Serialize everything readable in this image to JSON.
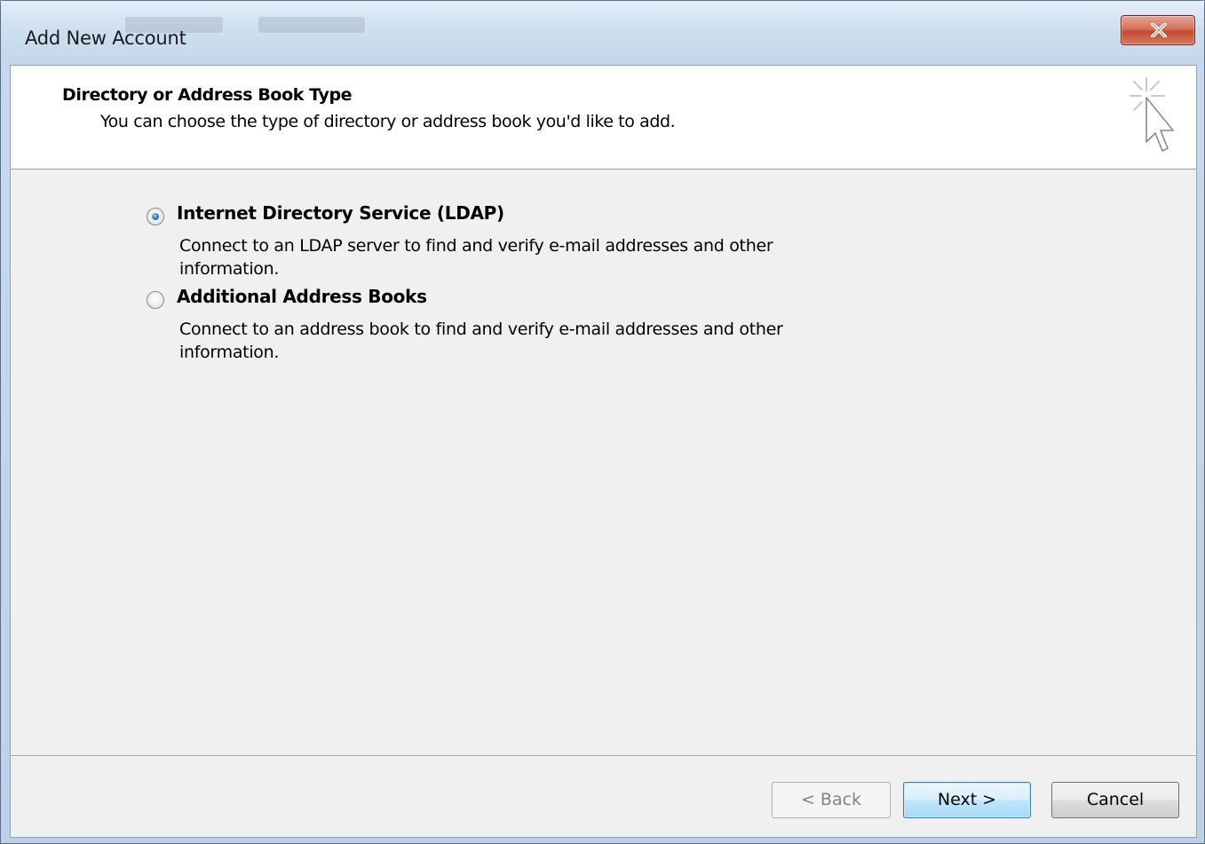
{
  "window": {
    "title": "Add New Account",
    "close_glyph": "x-icon"
  },
  "header": {
    "title": "Directory or Address Book Type",
    "subtitle": "You can choose the type of directory or address book you'd like to add.",
    "icon": "wizard-cursor-icon"
  },
  "options": [
    {
      "label": "Internet Directory Service (LDAP)",
      "description": "Connect to an LDAP server to find and verify e-mail addresses and other information.",
      "selected": true
    },
    {
      "label": "Additional Address Books",
      "description": "Connect to an address book to find and verify e-mail addresses and other information.",
      "selected": false
    }
  ],
  "buttons": {
    "back": {
      "label": "< Back",
      "enabled": false
    },
    "next": {
      "label": "Next >",
      "enabled": true,
      "default": true
    },
    "cancel": {
      "label": "Cancel",
      "enabled": true
    }
  },
  "colors": {
    "close_button": "#c24a30",
    "accent_default_button": "#3c7fb1",
    "radio_dot": "#2c6fc1"
  }
}
